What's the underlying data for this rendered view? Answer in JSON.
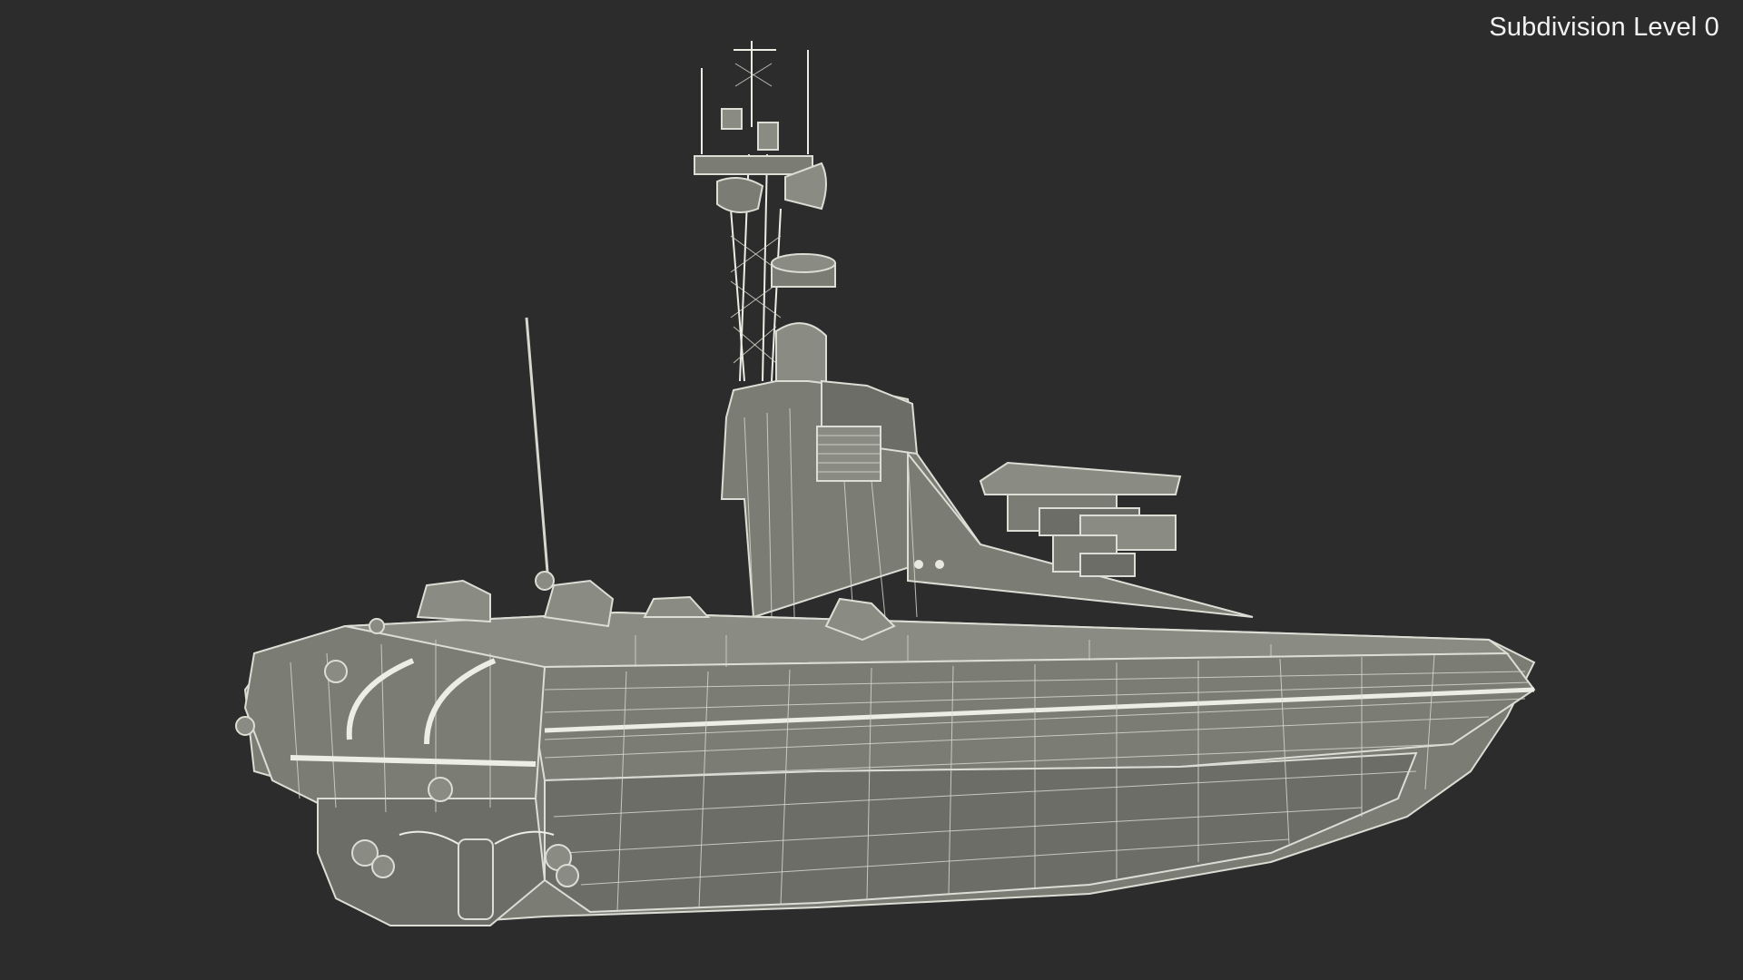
{
  "viewport": {
    "label": "Subdivision Level 0",
    "background_color": "#2c2c2c",
    "model_fill_color": "#7b7c74",
    "wireframe_color": "#dcddd4"
  }
}
